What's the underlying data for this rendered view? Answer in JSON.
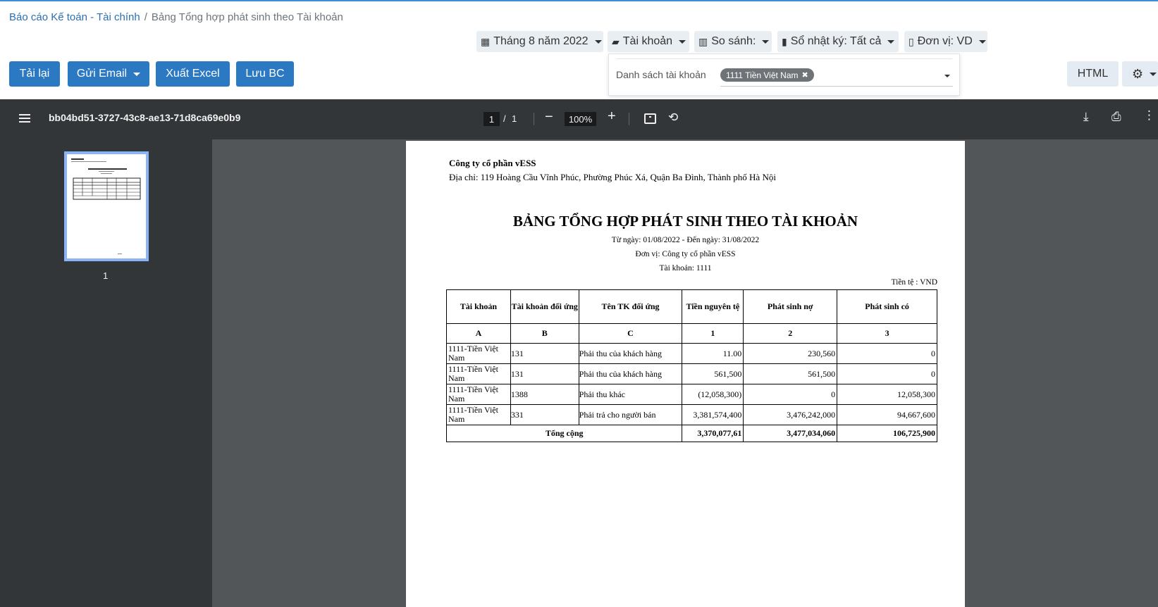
{
  "breadcrumb": {
    "parent": "Báo cáo Kế toán - Tài chính",
    "separator": "/",
    "current": "Bảng Tổng hợp phát sinh theo Tài khoản"
  },
  "filters": {
    "period": "Tháng 8 năm 2022",
    "account": "Tài khoản",
    "compare": "So sánh:",
    "journal": "Sổ nhật ký: Tất cả",
    "unit": "Đơn vị: VD"
  },
  "toolbar": {
    "reload": "Tải lại",
    "email": "Gửi Email",
    "excel": "Xuất Excel",
    "save": "Lưu BC",
    "html": "HTML"
  },
  "account_panel": {
    "label": "Danh sách tài khoản",
    "chip": "1111 Tiền Việt Nam",
    "chip_remove": "✖"
  },
  "viewer": {
    "doc_title": "bb04bd51-3727-43c8-ae13-71d8ca69e0b9",
    "page": "1",
    "page_sep": "/",
    "page_total": "1",
    "zoom": "100%",
    "minus": "−",
    "plus": "+",
    "thumb_label": "1"
  },
  "report": {
    "company": "Công ty cổ phần vESS",
    "address": "Địa chỉ: 119 Hoàng Cầu Vĩnh Phúc, Phường Phúc Xá, Quận Ba Đình, Thành phố Hà Nội",
    "title": "BẢNG TỔNG HỢP PHÁT SINH THEO TÀI KHOẢN",
    "date_range": "Từ ngày: 01/08/2022 - Đến ngày: 31/08/2022",
    "unit": "Đơn vị: Công ty cổ phần vESS",
    "account": "Tài khoản: 1111",
    "currency": "Tiền tệ : VND",
    "headers": [
      "Tài khoản",
      "Tài khoản đối ứng",
      "Tên TK đối ứng",
      "Tiền nguyên tệ",
      "Phát sinh nợ",
      "Phát sinh có"
    ],
    "codes": [
      "A",
      "B",
      "C",
      "1",
      "2",
      "3"
    ],
    "rows": [
      [
        "1111-Tiền Việt Nam",
        "131",
        "Phải thu của khách hàng",
        "11.00",
        "230,560",
        "0"
      ],
      [
        "1111-Tiền Việt Nam",
        "131",
        "Phải thu của khách hàng",
        "561,500",
        "561,500",
        "0"
      ],
      [
        "1111-Tiền Việt Nam",
        "1388",
        "Phải thu khác",
        "(12,058,300)",
        "0",
        "12,058,300"
      ],
      [
        "1111-Tiền Việt Nam",
        "331",
        "Phải trả cho người bán",
        "3,381,574,400",
        "3,476,242,000",
        "94,667,600"
      ]
    ],
    "total_label": "Tổng cộng",
    "totals": [
      "3,370,077,61",
      "3,477,034,060",
      "106,725,900"
    ]
  },
  "colors": {
    "primary_button": "#2b79c2",
    "viewer_bg": "#323639",
    "canvas_bg": "#525659",
    "link": "#2a6fb5"
  }
}
